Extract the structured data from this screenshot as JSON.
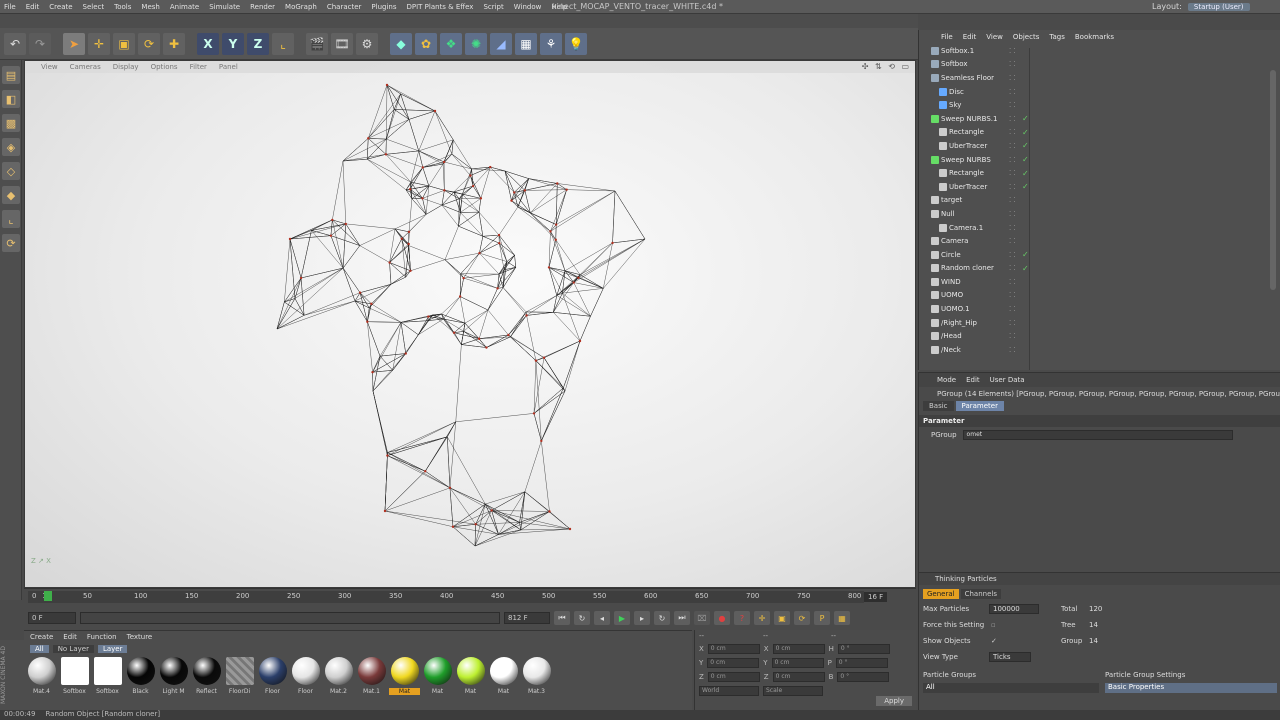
{
  "app": {
    "window_title": "kinect_MOCAP_VENTO_tracer_WHITE.c4d *",
    "menu": [
      "File",
      "Edit",
      "Create",
      "Select",
      "Tools",
      "Mesh",
      "Animate",
      "Simulate",
      "Render",
      "MoGraph",
      "Character",
      "Plugins",
      "DPIT Plants & Effex",
      "Script",
      "Window",
      "Help"
    ],
    "layout_label": "Layout:",
    "layout_value": "Startup (User)"
  },
  "toolbar": {
    "icons": [
      "undo-icon",
      "redo-icon",
      "select-icon",
      "move-icon",
      "scale-icon",
      "rotate-icon",
      "add-icon",
      "x-axis-icon",
      "y-axis-icon",
      "z-axis-icon",
      "coord-icon",
      "render-view-icon",
      "render-picture-icon",
      "render-settings-icon",
      "cube-icon",
      "nurbs-icon",
      "array-icon",
      "deformer-icon",
      "floor-icon",
      "camera-icon",
      "light-icon"
    ],
    "axis_x": "X",
    "axis_y": "Y",
    "axis_z": "Z"
  },
  "viewport": {
    "menu": [
      "View",
      "Cameras",
      "Display",
      "Options",
      "Filter",
      "Panel"
    ],
    "nav": "✣ ⇅ ⟲ ▭",
    "axis_label": "Z ↗ X"
  },
  "timeline": {
    "ticks": [
      "0",
      "10",
      "50",
      "100",
      "150",
      "200",
      "250",
      "300",
      "350",
      "400",
      "450",
      "500",
      "550",
      "600",
      "650",
      "700",
      "750",
      "800"
    ],
    "current_frame": "16",
    "fps_field": "16 F",
    "start_field": "0 F",
    "end_field": "812 F",
    "range_text": "812 F"
  },
  "materials": {
    "menu": [
      "Create",
      "Edit",
      "Function",
      "Texture"
    ],
    "tabs": [
      "All",
      "No Layer",
      "Layer"
    ],
    "items": [
      {
        "label": "Mat.4",
        "color": "#cfcfcf"
      },
      {
        "label": "Softbox",
        "color": "#ffffff"
      },
      {
        "label": "Softbox",
        "color": "#ffffff"
      },
      {
        "label": "Black",
        "color": "#050505"
      },
      {
        "label": "Light M",
        "color": "#080808"
      },
      {
        "label": "Reflect",
        "color": "#0a0a0a"
      },
      {
        "label": "FloorDi",
        "color": "#8c8c8c"
      },
      {
        "label": "Floor",
        "color": "#2b3f6a"
      },
      {
        "label": "Floor",
        "color": "#e5e5e5"
      },
      {
        "label": "Mat.2",
        "color": "#cfcfcf"
      },
      {
        "label": "Mat.1",
        "color": "#7a3a3a"
      },
      {
        "label": "Mat",
        "color": "#f0d820"
      },
      {
        "label": "Mat",
        "color": "#1f9e2a"
      },
      {
        "label": "Mat",
        "color": "#bdf030"
      },
      {
        "label": "Mat",
        "color": "#ffffff"
      },
      {
        "label": "Mat.3",
        "color": "#e8e8e8"
      }
    ],
    "selected_index": 11
  },
  "coords": {
    "header": [
      "--",
      "--",
      "--"
    ],
    "rows": [
      {
        "a": "X",
        "av": "0 cm",
        "b": "X",
        "bv": "0 cm",
        "c": "H",
        "cv": "0 °"
      },
      {
        "a": "Y",
        "av": "0 cm",
        "b": "Y",
        "bv": "0 cm",
        "c": "P",
        "cv": "0 °"
      },
      {
        "a": "Z",
        "av": "0 cm",
        "b": "Z",
        "bv": "0 cm",
        "c": "B",
        "cv": "0 °"
      }
    ],
    "world": "World",
    "scale": "Scale",
    "apply": "Apply"
  },
  "status": {
    "time": "00:00:49",
    "text": "Random Object [Random cloner]"
  },
  "brand": "MAXON CINEMA 4D",
  "object_manager": {
    "menu": [
      "File",
      "Edit",
      "View",
      "Objects",
      "Tags",
      "Bookmarks"
    ],
    "rows": [
      {
        "name": "Softbox.1",
        "indent": 0,
        "icon": "#9ab",
        "check": false
      },
      {
        "name": "Softbox",
        "indent": 0,
        "icon": "#9ab",
        "check": false
      },
      {
        "name": "Seamless Floor",
        "indent": 0,
        "icon": "#9ab",
        "check": false
      },
      {
        "name": "Disc",
        "indent": 1,
        "icon": "#6af",
        "check": false
      },
      {
        "name": "Sky",
        "indent": 1,
        "icon": "#6af",
        "check": false
      },
      {
        "name": "Sweep NURBS.1",
        "indent": 0,
        "icon": "#6d6",
        "check": true
      },
      {
        "name": "Rectangle",
        "indent": 1,
        "icon": "#ccc",
        "check": true
      },
      {
        "name": "UberTracer",
        "indent": 1,
        "icon": "#ccc",
        "check": true
      },
      {
        "name": "Sweep NURBS",
        "indent": 0,
        "icon": "#6d6",
        "check": true
      },
      {
        "name": "Rectangle",
        "indent": 1,
        "icon": "#ccc",
        "check": true
      },
      {
        "name": "UberTracer",
        "indent": 1,
        "icon": "#ccc",
        "check": true
      },
      {
        "name": "target",
        "indent": 0,
        "icon": "#ccc",
        "check": false
      },
      {
        "name": "Null",
        "indent": 0,
        "icon": "#ccc",
        "check": false
      },
      {
        "name": "Camera.1",
        "indent": 1,
        "icon": "#ccc",
        "check": false
      },
      {
        "name": "Camera",
        "indent": 0,
        "icon": "#ccc",
        "check": false
      },
      {
        "name": "Circle",
        "indent": 0,
        "icon": "#ccc",
        "check": true
      },
      {
        "name": "Random cloner",
        "indent": 0,
        "icon": "#ccc",
        "check": true
      },
      {
        "name": "WIND",
        "indent": 0,
        "icon": "#ccc",
        "check": false
      },
      {
        "name": "UOMO",
        "indent": 0,
        "icon": "#ccc",
        "check": false
      },
      {
        "name": "UOMO.1",
        "indent": 0,
        "icon": "#ccc",
        "check": false
      },
      {
        "name": "/Right_Hip",
        "indent": 0,
        "icon": "#ccc",
        "check": false
      },
      {
        "name": "/Head",
        "indent": 0,
        "icon": "#ccc",
        "check": false
      },
      {
        "name": "/Neck",
        "indent": 0,
        "icon": "#ccc",
        "check": false
      }
    ]
  },
  "attributes": {
    "menu": [
      "Mode",
      "Edit",
      "User Data"
    ],
    "title": "PGroup (14 Elements) [PGroup, PGroup, PGroup, PGroup, PGroup, PGroup, PGroup, PGroup, PGroup, P",
    "tabs": [
      "Basic",
      "Parameter"
    ],
    "section": "Parameter",
    "param_label": "PGroup",
    "param_value": "omet"
  },
  "thinking": {
    "title": "Thinking Particles",
    "tabs": [
      "General",
      "Channels"
    ],
    "max_particles_label": "Max Particles",
    "max_particles": "100000",
    "total_label": "Total",
    "total": "120",
    "force_label": "Force this Setting",
    "tree_label": "Tree",
    "tree": "14",
    "show_label": "Show Objects",
    "group_label": "Group",
    "group": "14",
    "view_label": "View Type",
    "view_value": "Ticks",
    "groups_label": "Particle Groups",
    "group_all": "All",
    "settings_label": "Particle Group Settings",
    "basic_props": "Basic Properties"
  }
}
